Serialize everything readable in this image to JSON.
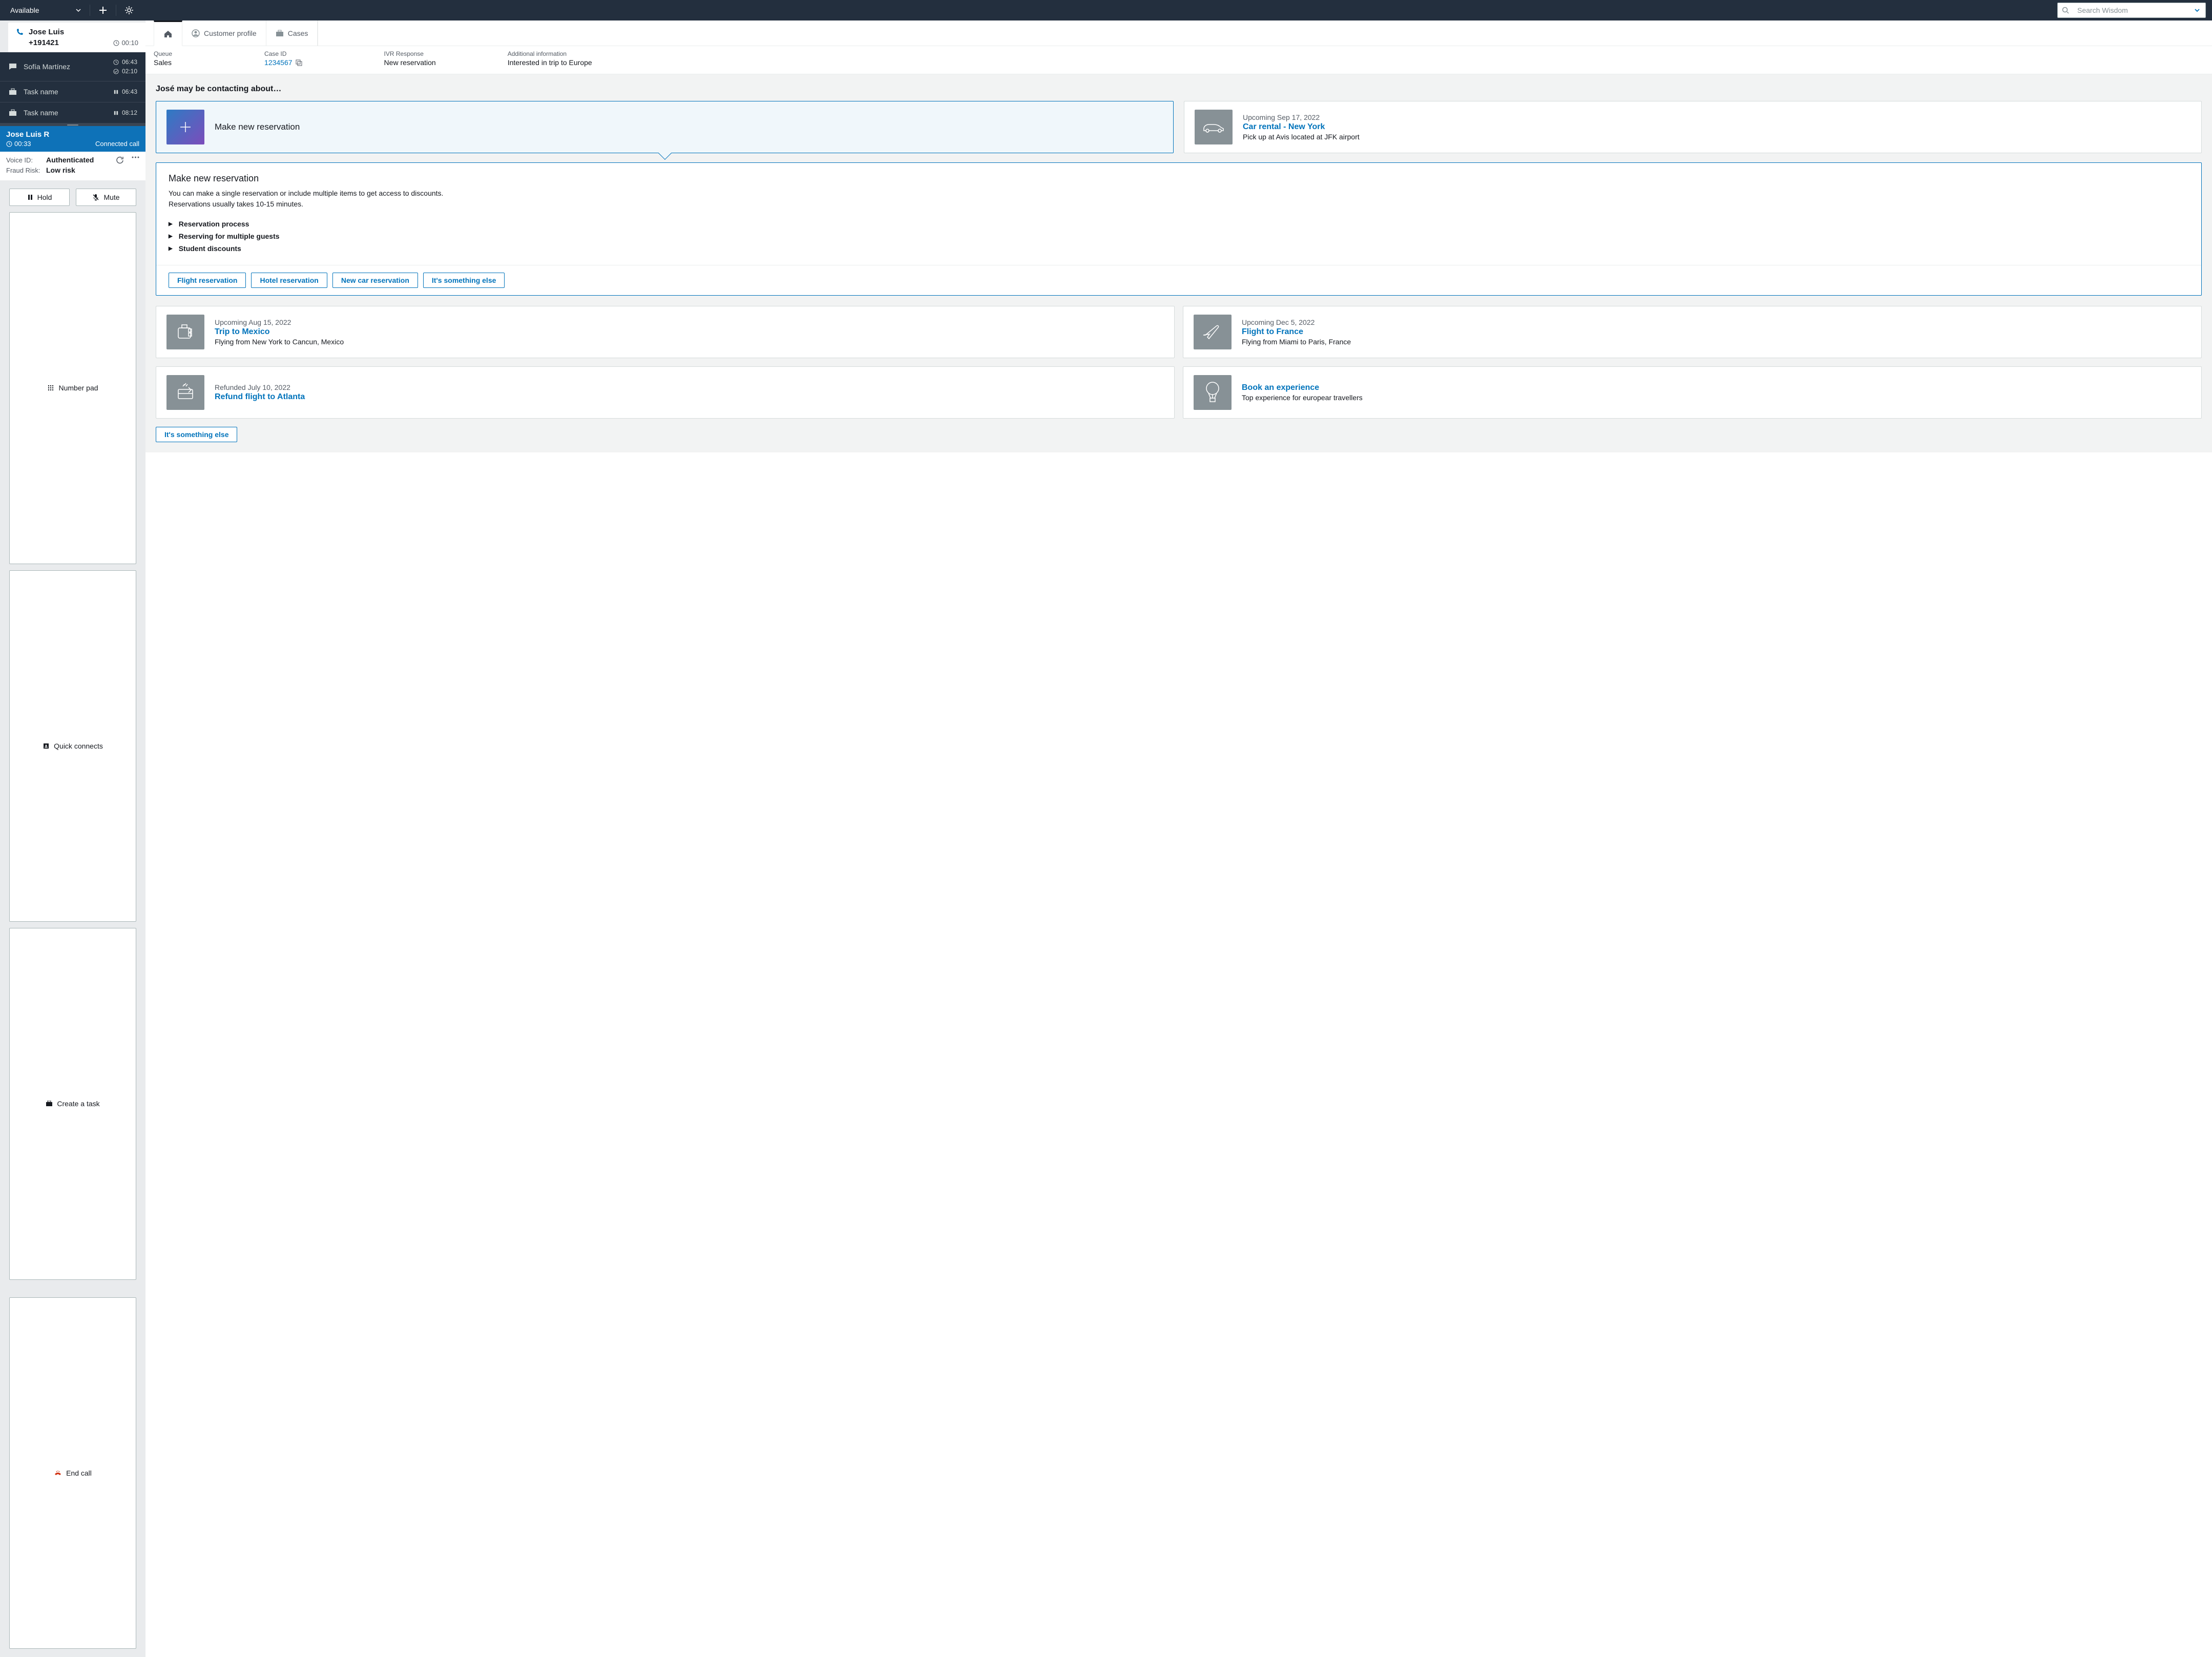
{
  "topbar": {
    "status": "Available",
    "search_placeholder": "Search Wisdom"
  },
  "sidebar": {
    "active_contact": {
      "name": "Jose Luis",
      "phone": "+191421",
      "duration": "00:10"
    },
    "contacts": [
      {
        "name": "Sofía Martínez",
        "t1": "06:43",
        "t2": "02:10",
        "type": "chat"
      },
      {
        "name": "Task name",
        "t1": "06:43",
        "type": "task"
      },
      {
        "name": "Task name",
        "t1": "08:12",
        "type": "task"
      }
    ],
    "call": {
      "name": "Jose Luis R",
      "duration": "00:33",
      "status": "Connected call"
    },
    "voice": {
      "voice_id_label": "Voice ID:",
      "voice_id_value": "Authenticated",
      "fraud_label": "Fraud Risk:",
      "fraud_value": "Low risk"
    },
    "buttons": {
      "hold": "Hold",
      "mute": "Mute",
      "numpad": "Number pad",
      "quick": "Quick connects",
      "task": "Create a task",
      "end": "End call"
    }
  },
  "main": {
    "tabs": {
      "profile": "Customer profile",
      "cases": "Cases"
    },
    "info": {
      "queue_label": "Queue",
      "queue_value": "Sales",
      "case_label": "Case ID",
      "case_value": "1234567",
      "ivr_label": "IVR Response",
      "ivr_value": "New reservation",
      "addl_label": "Additional information",
      "addl_value": "Interested in trip to Europe"
    },
    "section_title": "José may be contacting about…",
    "top_cards": [
      {
        "title": "Make new reservation"
      },
      {
        "date": "Upcoming Sep 17, 2022",
        "title": "Car rental - New York",
        "desc": "Pick up at Avis located at JFK airport"
      }
    ],
    "detail": {
      "title": "Make new reservation",
      "desc1": "You can make a single reservation or include multiple items to get access to discounts.",
      "desc2": "Reservations usually takes 10-15 minutes.",
      "items": [
        "Reservation process",
        "Reserving for multiple guests",
        "Student discounts"
      ],
      "actions": [
        "Flight reservation",
        "Hotel reservation",
        "New car reservation",
        "It's something else"
      ]
    },
    "bottom_cards": [
      {
        "date": "Upcoming Aug 15, 2022",
        "title": "Trip to Mexico",
        "desc": "Flying from New York to Cancun, Mexico"
      },
      {
        "date": "Upcoming Dec 5, 2022",
        "title": "Flight to France",
        "desc": "Flying from Miami to Paris, France"
      },
      {
        "date": "Refunded July 10, 2022",
        "title": "Refund flight to Atlanta",
        "desc": ""
      },
      {
        "date": "",
        "title": "Book an experience",
        "desc": "Top experience for europear travellers"
      }
    ],
    "footer_btn": "It's something else"
  }
}
